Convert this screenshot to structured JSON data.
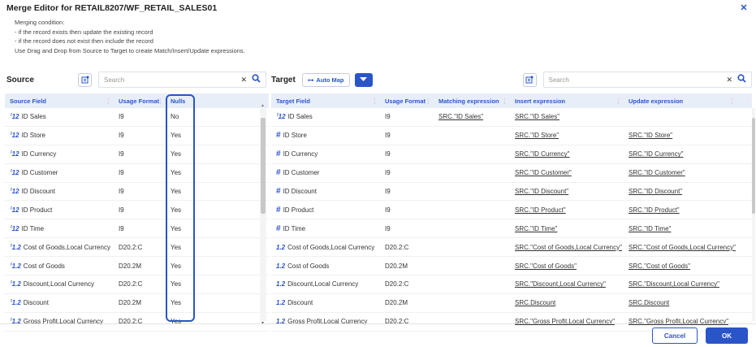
{
  "window": {
    "title": "Merge Editor for RETAIL8207/WF_RETAIL_SALES01"
  },
  "conditions": [
    "Merging condition:",
    "- if the record exists then update the existing record",
    "- if the record does not exist then include the record",
    "Use Drag and Drop from Source to Target to create Match/Insert/Update expressions."
  ],
  "source": {
    "title": "Source",
    "search_placeholder": "Search",
    "columns": [
      "Source Field",
      "Usage Format",
      "Nulls"
    ],
    "rows": [
      {
        "icon": "integer",
        "field": "ID Sales",
        "format": "I9",
        "nulls": "No"
      },
      {
        "icon": "integer",
        "field": "ID Store",
        "format": "I9",
        "nulls": "Yes"
      },
      {
        "icon": "integer",
        "field": "ID Currency",
        "format": "I9",
        "nulls": "Yes"
      },
      {
        "icon": "integer",
        "field": "ID Customer",
        "format": "I9",
        "nulls": "Yes"
      },
      {
        "icon": "integer",
        "field": "ID Discount",
        "format": "I9",
        "nulls": "Yes"
      },
      {
        "icon": "integer",
        "field": "ID Product",
        "format": "I9",
        "nulls": "Yes"
      },
      {
        "icon": "integer",
        "field": "ID Time",
        "format": "I9",
        "nulls": "Yes"
      },
      {
        "icon": "decimal",
        "field": "Cost of Goods,Local Currency",
        "format": "D20.2:C",
        "nulls": "Yes"
      },
      {
        "icon": "decimal",
        "field": "Cost of Goods",
        "format": "D20.2M",
        "nulls": "Yes"
      },
      {
        "icon": "decimal",
        "field": "Discount,Local Currency",
        "format": "D20.2:C",
        "nulls": "Yes"
      },
      {
        "icon": "decimal",
        "field": "Discount",
        "format": "D20.2M",
        "nulls": "Yes"
      },
      {
        "icon": "decimal",
        "field": "Gross Profit,Local Currency",
        "format": "D20.2:C",
        "nulls": "Yes"
      }
    ]
  },
  "target": {
    "title": "Target",
    "automap_label": "Auto Map",
    "search_placeholder": "Search",
    "columns": [
      "Target Field",
      "Usage Format",
      "Matching expression",
      "Insert expression",
      "Update expression"
    ],
    "rows": [
      {
        "icon": "integer",
        "field": "ID Sales",
        "format": "I9",
        "match": "SRC.\"ID Sales\"",
        "insert": "SRC.\"ID Sales\"",
        "update": ""
      },
      {
        "icon": "key",
        "field": "ID Store",
        "format": "I9",
        "match": "",
        "insert": "SRC.\"ID Store\"",
        "update": "SRC.\"ID Store\""
      },
      {
        "icon": "key",
        "field": "ID Currency",
        "format": "I9",
        "match": "",
        "insert": "SRC.\"ID Currency\"",
        "update": "SRC.\"ID Currency\""
      },
      {
        "icon": "key",
        "field": "ID Customer",
        "format": "I9",
        "match": "",
        "insert": "SRC.\"ID Customer\"",
        "update": "SRC.\"ID Customer\""
      },
      {
        "icon": "key",
        "field": "ID Discount",
        "format": "I9",
        "match": "",
        "insert": "SRC.\"ID Discount\"",
        "update": "SRC.\"ID Discount\""
      },
      {
        "icon": "key",
        "field": "ID Product",
        "format": "I9",
        "match": "",
        "insert": "SRC.\"ID Product\"",
        "update": "SRC.\"ID Product\""
      },
      {
        "icon": "key",
        "field": "ID Time",
        "format": "I9",
        "match": "",
        "insert": "SRC.\"ID Time\"",
        "update": "SRC.\"ID Time\""
      },
      {
        "icon": "decimal-tgt",
        "field": "Cost of Goods,Local Currency",
        "format": "D20.2:C",
        "match": "",
        "insert": "SRC.\"Cost of Goods,Local Currency\"",
        "update": "SRC.\"Cost of Goods,Local Currency\""
      },
      {
        "icon": "decimal-tgt",
        "field": "Cost of Goods",
        "format": "D20.2M",
        "match": "",
        "insert": "SRC.\"Cost of Goods\"",
        "update": "SRC.\"Cost of Goods\""
      },
      {
        "icon": "decimal-tgt",
        "field": "Discount,Local Currency",
        "format": "D20.2:C",
        "match": "",
        "insert": "SRC.\"Discount,Local Currency\"",
        "update": "SRC.\"Discount,Local Currency\""
      },
      {
        "icon": "decimal-tgt",
        "field": "Discount",
        "format": "D20.2M",
        "match": "",
        "insert": "SRC.Discount",
        "update": "SRC.Discount"
      },
      {
        "icon": "decimal-tgt",
        "field": "Gross Profit,Local Currency",
        "format": "D20.2:C",
        "match": "",
        "insert": "SRC.\"Gross Profit,Local Currency\"",
        "update": "SRC.\"Gross Profit,Local Currency\""
      }
    ]
  },
  "icons": {
    "integer": "ꜝ12",
    "key": "#",
    "decimal": "ꜝ1.2",
    "decimal-tgt": "1.2"
  },
  "footer": {
    "cancel_label": "Cancel",
    "ok_label": "OK"
  },
  "colors": {
    "accent": "#2a55c8",
    "header_bg": "#e8eef8"
  }
}
